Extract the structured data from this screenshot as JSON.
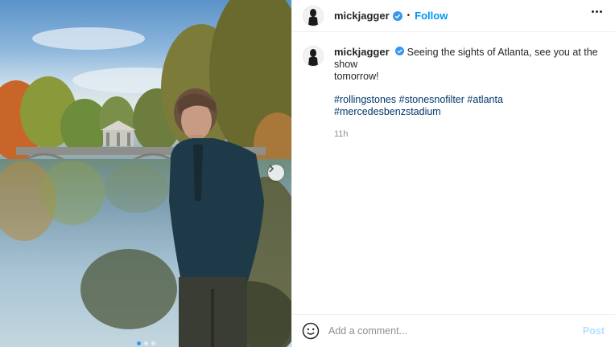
{
  "post": {
    "image_alt": "Man in dark jacket standing beside a lake with autumn trees and a bridge",
    "carousel": {
      "total_slides": 3,
      "active_slide": 1
    }
  },
  "header": {
    "username": "mickjagger",
    "separator": "•",
    "follow_label": "Follow",
    "more_icon": "more-horizontal-icon"
  },
  "caption": {
    "username": "mickjagger",
    "text_line1": "Seeing the sights of Atlanta, see you at the show",
    "text_line2": "tomorrow!",
    "hashtags": [
      "#rollingstones",
      "#stonesnofilter",
      "#atlanta",
      "#mercedesbenzstadium"
    ],
    "timestamp": "11h"
  },
  "comment": {
    "placeholder": "Add a comment...",
    "post_label": "Post",
    "emoji_icon": "smiley-icon"
  },
  "colors": {
    "accent": "#0095f6",
    "verified": "#3897f0",
    "hashtag": "#00376b",
    "muted": "#8e8e8e",
    "post_disabled": "#b2dffc"
  }
}
